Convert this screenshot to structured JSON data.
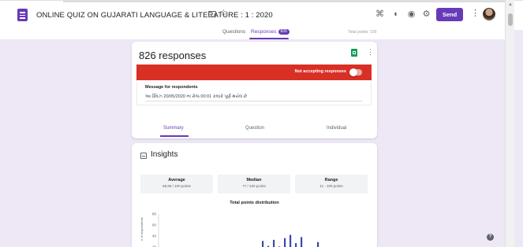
{
  "header": {
    "title": "ONLINE QUIZ ON GUJARATI LANGUAGE & LITERATURE : 1 : 2020",
    "send_label": "Send",
    "icons": [
      "folder-icon",
      "star-icon",
      "palette-icon",
      "preview-icon",
      "settings-icon",
      "more-vert-icon"
    ]
  },
  "tabs": {
    "questions": "Questions",
    "responses": "Responses",
    "responses_count": "826",
    "total_points": "Total points: 100"
  },
  "responses_card": {
    "count_label": "826 responses",
    "not_accepting": "Not accepting responses",
    "message_label": "Message for respondents",
    "message_value": "આ ક્વિઝ 20/05/2020 ના રોજ 00:01 કલાકે પૂર્ણ થયેલ છે",
    "sub_tabs": {
      "summary": "Summary",
      "question": "Question",
      "individual": "Individual"
    }
  },
  "insights": {
    "title": "Insights",
    "average": {
      "label": "Average",
      "value": "68.65 / 100 points"
    },
    "median": {
      "label": "Median",
      "value": "77 / 100 points"
    },
    "range": {
      "label": "Range",
      "value": "11 - 100 points"
    }
  },
  "chart_data": {
    "type": "bar",
    "title": "Total points distribution",
    "ylabel": "# of respondents",
    "yticks": [
      20,
      40,
      60,
      80
    ],
    "ylim": [
      0,
      80
    ],
    "values": [
      14,
      31,
      22,
      33,
      21,
      36,
      42,
      27,
      38,
      18,
      11,
      29
    ]
  },
  "colors": {
    "accent": "#673ab7",
    "red_bar": "#d93025",
    "sheets_green": "#0f9d58",
    "page_bg": "#ede7f6"
  }
}
